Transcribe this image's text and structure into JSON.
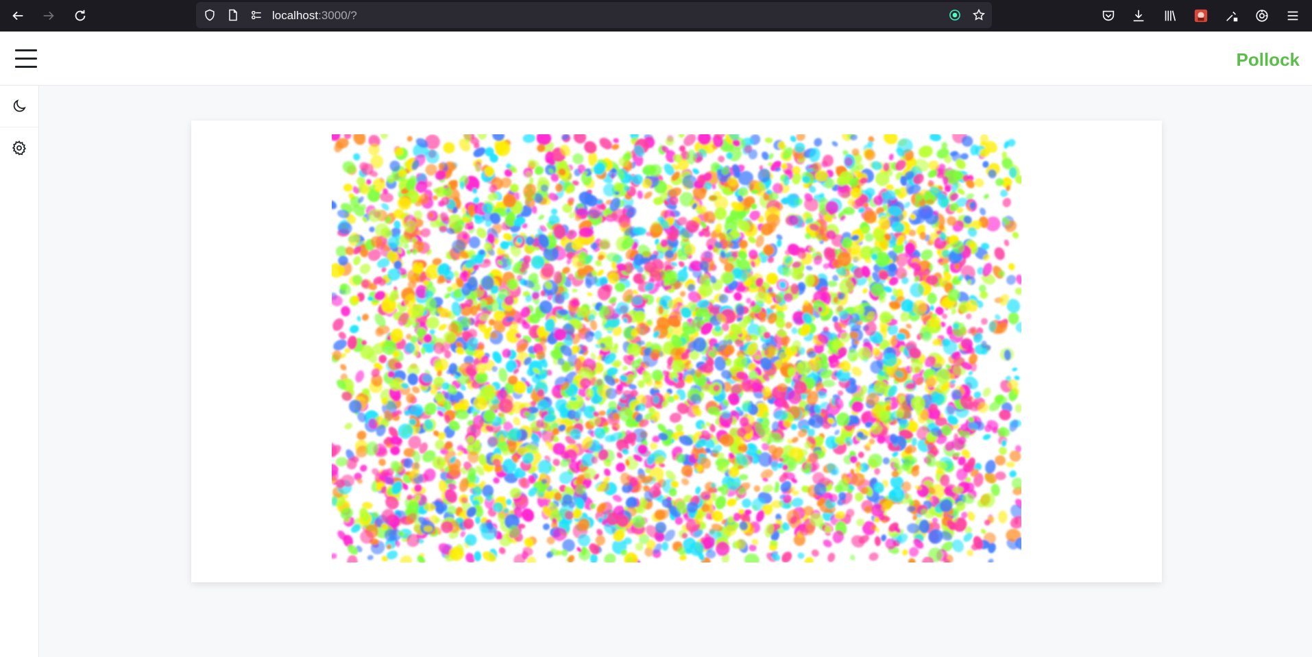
{
  "browser": {
    "url_host": "localhost",
    "url_rest": ":3000/?",
    "toolbar_icons": [
      "back-icon",
      "forward-icon",
      "reload-icon",
      "shield-icon",
      "page-icon",
      "permissions-icon",
      "extension-icon",
      "bookmark-star-icon",
      "pocket-icon",
      "download-icon",
      "library-icon",
      "extension-avatar-icon",
      "eyedropper-icon",
      "sync-icon",
      "menu-icon"
    ]
  },
  "app": {
    "brand": "Pollock",
    "brand_color": "#5bbd4a",
    "sidebar": [
      {
        "name": "theme-toggle",
        "icon": "moon-icon"
      },
      {
        "name": "settings",
        "icon": "gear-icon"
      }
    ]
  },
  "painting": {
    "palette": [
      "#ffee00",
      "#ff1fd0",
      "#19e2ff",
      "#7cff3a",
      "#ff8a1f",
      "#b9ff2e",
      "#3f7bff",
      "#ff3fa0"
    ]
  }
}
